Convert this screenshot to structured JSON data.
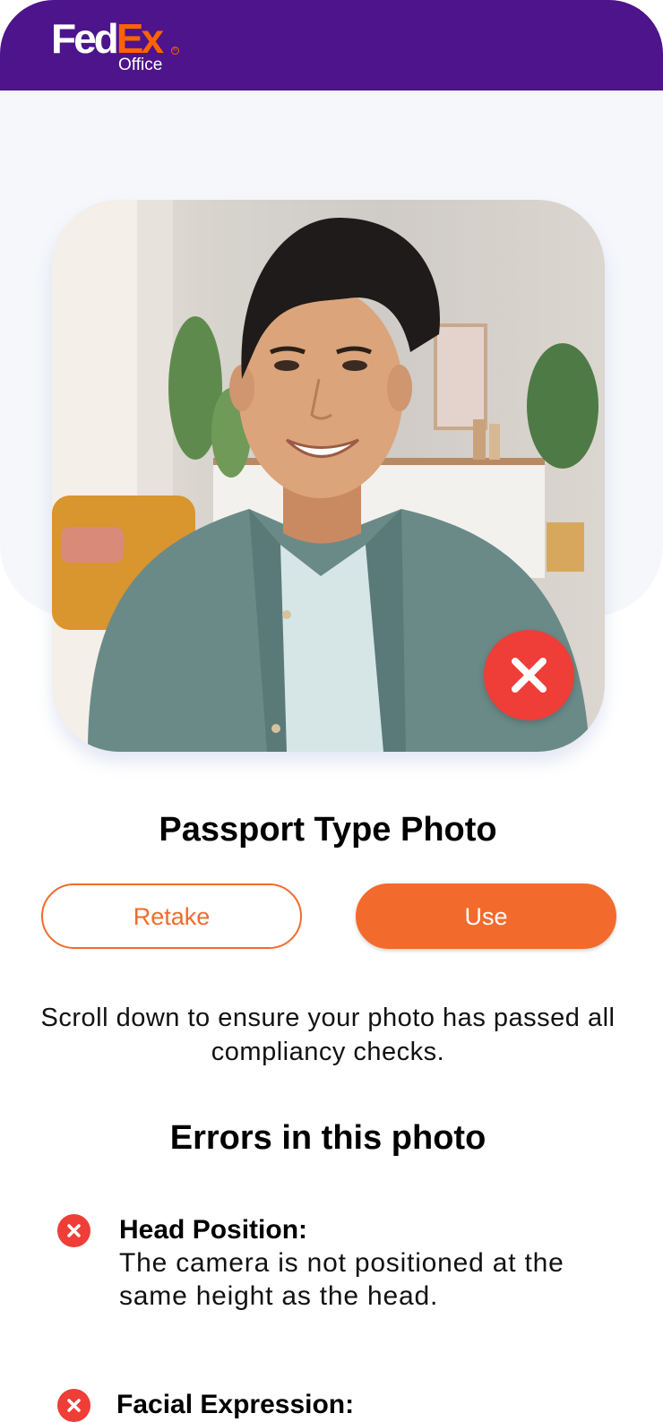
{
  "header": {
    "logo_fed": "Fed",
    "logo_ex": "Ex",
    "logo_office": "Office",
    "logo_reg": "®",
    "bg_color": "#4d148c"
  },
  "photo": {
    "status_icon": "close-icon",
    "status": "rejected"
  },
  "main": {
    "title": "Passport Type Photo",
    "retake_label": "Retake",
    "use_label": "Use",
    "hint": "Scroll down to ensure your photo has passed all compliancy checks.",
    "errors_heading": "Errors in this photo"
  },
  "errors": [
    {
      "title": "Head Position:",
      "description": "The camera is not positioned at the same height as the head.",
      "icon": "error-icon"
    },
    {
      "title": "Facial Expression:",
      "description": "",
      "icon": "error-icon"
    }
  ],
  "colors": {
    "accent": "#f26b2c",
    "error": "#ef3d37",
    "brand_purple": "#4d148c",
    "brand_orange": "#ff6200"
  }
}
